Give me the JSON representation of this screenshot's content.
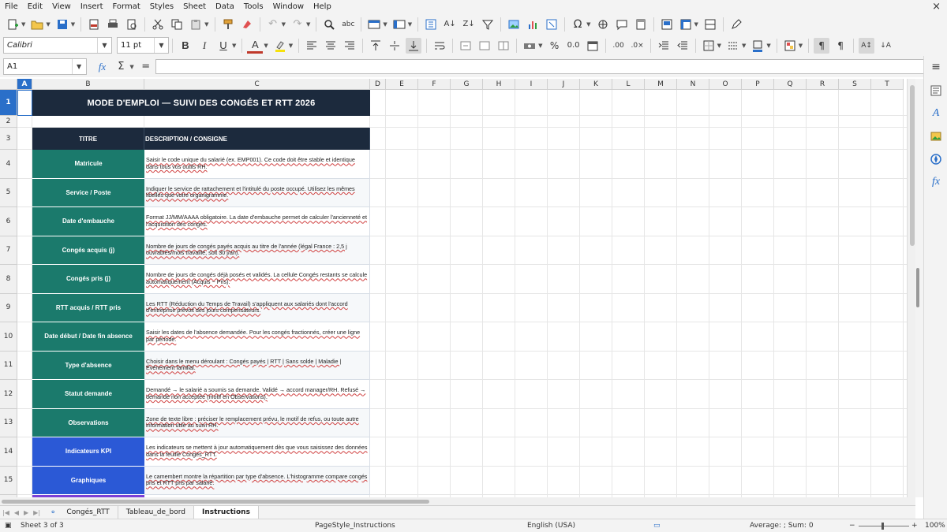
{
  "menu": [
    "File",
    "Edit",
    "View",
    "Insert",
    "Format",
    "Styles",
    "Sheet",
    "Data",
    "Tools",
    "Window",
    "Help"
  ],
  "close_glyph": "×",
  "toolbar2": {
    "font_name": "Calibri",
    "font_size": "11 pt"
  },
  "formula": {
    "name_box": "A1",
    "fx": "fx",
    "sum": "Σ",
    "eq": "=",
    "content": ""
  },
  "columns": [
    {
      "letter": "A",
      "selected": true
    },
    {
      "letter": "B"
    },
    {
      "letter": "C"
    },
    {
      "letter": "D"
    },
    {
      "letter": "E"
    },
    {
      "letter": "F"
    },
    {
      "letter": "G"
    },
    {
      "letter": "H"
    },
    {
      "letter": "I"
    },
    {
      "letter": "J"
    },
    {
      "letter": "K"
    },
    {
      "letter": "L"
    },
    {
      "letter": "M"
    },
    {
      "letter": "N"
    },
    {
      "letter": "O"
    },
    {
      "letter": "P"
    },
    {
      "letter": "Q"
    },
    {
      "letter": "R"
    },
    {
      "letter": "S"
    },
    {
      "letter": "T"
    }
  ],
  "sheet": {
    "title": "MODE D'EMPLOI — SUIVI DES CONGÉS ET RTT 2026",
    "header_titre": "TITRE",
    "header_desc": "DESCRIPTION / CONSIGNE",
    "rows": [
      {
        "num": "4",
        "label": "Matricule",
        "color": "teal",
        "desc": "Saisir le code unique du salarié (ex. EMP001). Ce code doit être stable et identique dans tous vos outils RH."
      },
      {
        "num": "5",
        "label": "Service / Poste",
        "color": "teal",
        "desc": "Indiquer le service de rattachement et l'intitulé du poste occupé. Utilisez les mêmes libellés que votre organigramme."
      },
      {
        "num": "6",
        "label": "Date d'embauche",
        "color": "teal",
        "desc": "Format JJ/MM/AAAA obligatoire. La date d'embauche permet de calculer l'ancienneté et l'acquisition des congés."
      },
      {
        "num": "7",
        "label": "Congés acquis (j)",
        "color": "teal",
        "desc": "Nombre de jours de congés payés acquis au titre de l'année (légal France : 2,5 j ouvrables/mois travaillé, soit 30 j/an)."
      },
      {
        "num": "8",
        "label": "Congés pris (j)",
        "color": "teal",
        "desc": "Nombre de jours de congés déjà posés et validés. La cellule Congés restants se calcule automatiquement (Acquis − Pris)."
      },
      {
        "num": "9",
        "label": "RTT acquis / RTT pris",
        "color": "teal",
        "desc": "Les RTT (Réduction du Temps de Travail) s'appliquent aux salariés dont l'accord d'entreprise prévoit des jours compensateurs."
      },
      {
        "num": "10",
        "label": "Date début / Date fin absence",
        "color": "teal",
        "desc": "Saisir les dates de l'absence demandée. Pour les congés fractionnés, créer une ligne par période."
      },
      {
        "num": "11",
        "label": "Type d'absence",
        "color": "teal",
        "desc": "Choisir dans le menu déroulant : Congés payés | RTT | Sans solde | Maladie | Événement familial."
      },
      {
        "num": "12",
        "label": "Statut demande",
        "color": "teal",
        "desc": "Demandé → le salarié a soumis sa demande. Validé → accord manager/RH. Refusé → demande non acceptée (motif en Observations)."
      },
      {
        "num": "13",
        "label": "Observations",
        "color": "teal",
        "desc": "Zone de texte libre : préciser le remplacement prévu, le motif de refus, ou toute autre information utile au suivi RH."
      },
      {
        "num": "14",
        "label": "Indicateurs KPI",
        "color": "blue",
        "desc": "Les indicateurs se mettent à jour automatiquement dès que vous saisissez des données dans la feuille Congés_RTT."
      },
      {
        "num": "15",
        "label": "Graphiques",
        "color": "blue",
        "desc": "Le camembert montre la répartition par type d'absence. L'histogramme compare congés pris et RTT pris par salarié."
      }
    ]
  },
  "row_numbers_top": [
    "1",
    "2",
    "3"
  ],
  "tabs": [
    "Congés_RTT",
    "Tableau_de_bord",
    "Instructions"
  ],
  "active_tab": "Instructions",
  "status": {
    "sheet": "Sheet 3 of 3",
    "page_style": "PageStyle_Instructions",
    "language": "English (USA)",
    "summary": "Average: ; Sum: 0",
    "zoom": "100%"
  }
}
